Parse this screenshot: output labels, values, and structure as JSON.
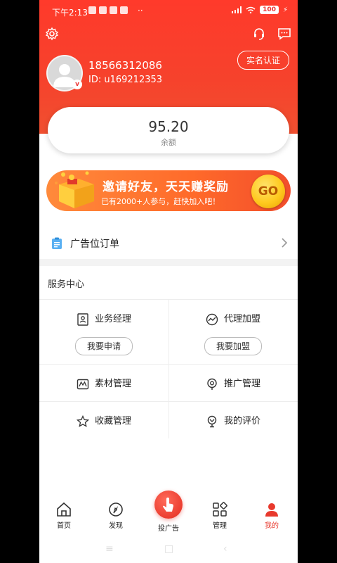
{
  "status_bar": {
    "time": "下午2:13",
    "battery": "100"
  },
  "profile": {
    "phone": "18566312086",
    "user_id": "ID: u169212353",
    "verify_label": "实名认证"
  },
  "balance": {
    "value": "95.20",
    "label": "余额"
  },
  "promo": {
    "title": "邀请好友，天天赚奖励",
    "subtitle": "已有2000+人参与，赶快加入吧！",
    "go_label": "GO"
  },
  "orders": {
    "label": "广告位订单"
  },
  "services": {
    "title": "服务中心",
    "items": [
      {
        "label": "业务经理",
        "action": "我要申请",
        "icon": "id-card-icon"
      },
      {
        "label": "代理加盟",
        "action": "我要加盟",
        "icon": "trend-icon"
      },
      {
        "label": "素材管理",
        "icon": "image-icon"
      },
      {
        "label": "推广管理",
        "icon": "location-icon"
      },
      {
        "label": "收藏管理",
        "icon": "star-icon"
      },
      {
        "label": "我的评价",
        "icon": "trophy-icon"
      }
    ]
  },
  "tabbar": {
    "tabs": [
      {
        "label": "首页",
        "icon": "home-icon"
      },
      {
        "label": "发现",
        "icon": "discover-icon"
      },
      {
        "label": "投广告",
        "icon": "tap-icon"
      },
      {
        "label": "管理",
        "icon": "grid-icon"
      },
      {
        "label": "我的",
        "icon": "person-icon"
      }
    ],
    "active_color": "#e8392d"
  },
  "colors": {
    "brand_red": "#f6422c",
    "promo_orange": "#ff7a33",
    "gold": "#ffc91f"
  }
}
